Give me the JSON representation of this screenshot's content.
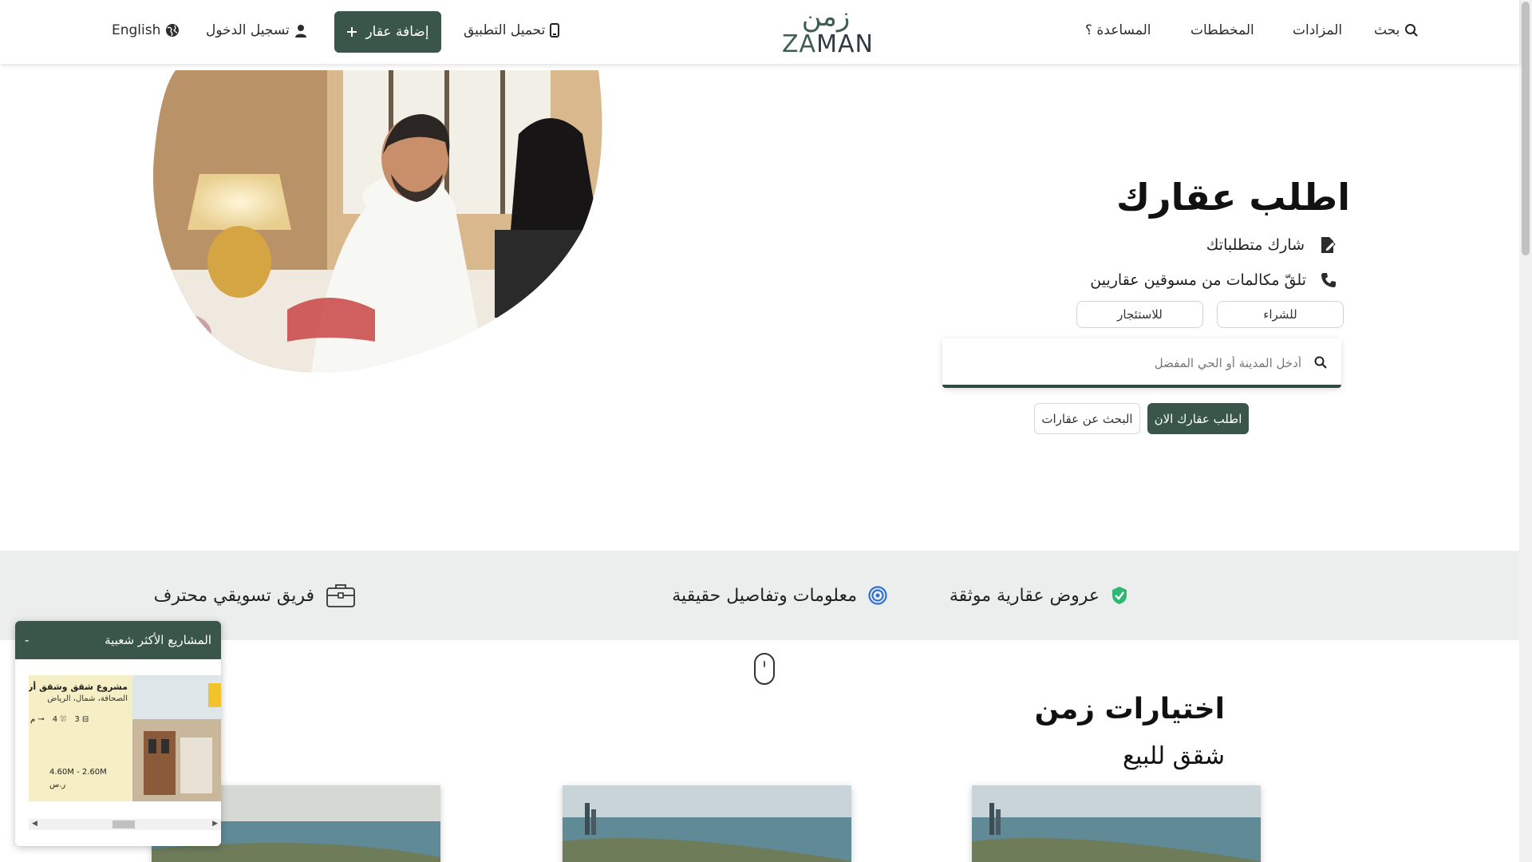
{
  "header": {
    "search": "بحث",
    "auctions": "المزادات",
    "plans": "المخططات",
    "help": "المساعدة ؟",
    "logo_ar": "زمن",
    "logo_en_a": "ZA",
    "logo_en_b": "MAN",
    "download_app": "تحميل التطبيق",
    "add_property": "إضافة عقار",
    "login": "تسجيل الدخول",
    "language": "English"
  },
  "hero": {
    "title": "اطلب عقارك",
    "feature_1": "شارك متطلباتك",
    "feature_2": "تلقّ مكالمات من مسوقين عقاريين",
    "buy_label": "للشراء",
    "rent_label": "للاستئجار",
    "search_placeholder": "أدخل المدينة أو الحي المفضل",
    "request_now": "اطلب عقارك الان",
    "search_properties": "البحث عن عقارات"
  },
  "features_band": {
    "verified": "عروض عقارية موثقة",
    "real_info": "معلومات وتفاصيل حقيقية",
    "marketing_team": "فريق تسويقي محترف"
  },
  "section": {
    "title": "اختيارات زمن",
    "subtitle": "شقق للبيع"
  },
  "popular_widget": {
    "title": "المشاريع الأكثر شعبية",
    "collapse": "-",
    "card": {
      "title": "مشروع شقق وشقق أرا",
      "location": "الصحافة، شمال، الرياض",
      "beds": "3",
      "baths": "4",
      "area_unit": "م",
      "price": "4.60M - 2.60M",
      "currency": "ر.س"
    }
  },
  "colors": {
    "brand_green": "#3a564a",
    "band_bg": "#ebeeed",
    "verified_green": "#2eb872",
    "target_blue": "#2f6fd6"
  }
}
